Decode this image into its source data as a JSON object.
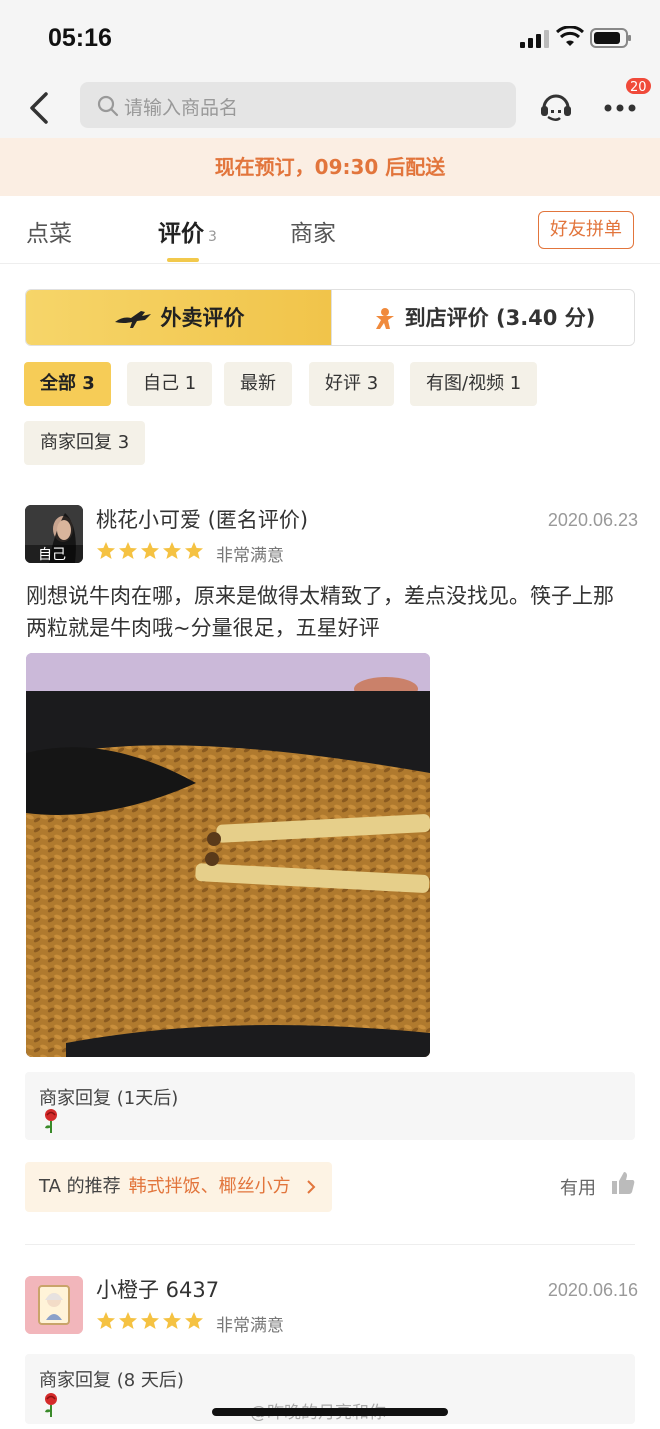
{
  "status": {
    "time": "05:16"
  },
  "nav": {
    "search_placeholder": "请输入商品名",
    "more_badge": "20"
  },
  "banner": {
    "text": "现在预订，09:30 后配送"
  },
  "tabs": [
    {
      "label": "点菜"
    },
    {
      "label": "评价",
      "count": "3"
    },
    {
      "label": "商家"
    }
  ],
  "group_order": "好友拼单",
  "review_switch": {
    "delivery": "外卖评价",
    "instore": "到店评价 (3.40 分)"
  },
  "filters": [
    "全部 3",
    "自己 1",
    "最新",
    "好评 3",
    "有图/视频 1",
    "商家回复 3"
  ],
  "reviews": [
    {
      "user": "桃花小可爱 (匿名评价)",
      "avatar_tag": "自己",
      "date": "2020.06.23",
      "stars": 5,
      "rating_text": "非常满意",
      "content": "刚想说牛肉在哪，原来是做得太精致了，差点没找见。筷子上那两粒就是牛肉哦~分量很足，五星好评",
      "reply_title": "商家回复 (1天后)",
      "recommend_label": "TA 的推荐",
      "recommend_dishes": "韩式拌饭、椰丝小方",
      "useful_label": "有用"
    },
    {
      "user": "小橙子 6437",
      "date": "2020.06.16",
      "stars": 5,
      "rating_text": "非常满意",
      "reply_title": "商家回复 (8 天后)"
    }
  ],
  "watermark": "@昨晚的月亮和你",
  "colors": {
    "accent": "#e2753c",
    "yellow": "#f6cc57",
    "star": "#f5c242"
  }
}
